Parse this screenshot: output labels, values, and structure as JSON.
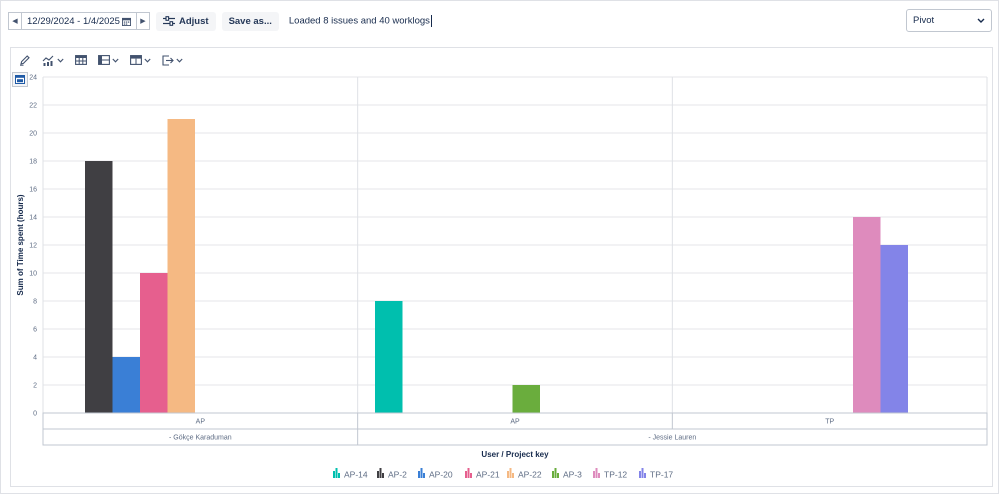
{
  "toolbar": {
    "date_range": "12/29/2024 - 1/4/2025",
    "adjust_label": "Adjust",
    "save_as_label": "Save as...",
    "status_text": "Loaded 8 issues and 40 worklogs",
    "view_select": "Pivot"
  },
  "chart_data": {
    "type": "bar",
    "ylabel": "Sum of Time spent (hours)",
    "xlabel": "User / Project key",
    "ylim": [
      0,
      24
    ],
    "yticks": [
      0,
      2,
      4,
      6,
      8,
      10,
      12,
      14,
      16,
      18,
      20,
      22,
      24
    ],
    "grid": true,
    "legend_position": "bottom",
    "groups": [
      {
        "project": "AP",
        "user": "- Gökçe Karaduman",
        "bars": [
          {
            "issue": "AP-2",
            "value": 18
          },
          {
            "issue": "AP-20",
            "value": 4
          },
          {
            "issue": "AP-21",
            "value": 10
          },
          {
            "issue": "AP-22",
            "value": 21
          }
        ]
      },
      {
        "project": "AP",
        "user": "- Jessie Lauren",
        "bars": [
          {
            "issue": "AP-14",
            "value": 8
          },
          {
            "issue": "AP-3",
            "value": 2
          }
        ]
      },
      {
        "project": "TP",
        "user": "- Jessie Lauren",
        "bars": [
          {
            "issue": "TP-12",
            "value": 14
          },
          {
            "issue": "TP-17",
            "value": 12
          }
        ]
      }
    ],
    "series": [
      {
        "name": "AP-14",
        "color": "#00bfae"
      },
      {
        "name": "AP-2",
        "color": "#403f43"
      },
      {
        "name": "AP-20",
        "color": "#3a7fd6"
      },
      {
        "name": "AP-21",
        "color": "#e65f8e"
      },
      {
        "name": "AP-22",
        "color": "#f5b983"
      },
      {
        "name": "AP-3",
        "color": "#6aad3d"
      },
      {
        "name": "TP-12",
        "color": "#de8bbd"
      },
      {
        "name": "TP-17",
        "color": "#8384e8"
      }
    ]
  }
}
